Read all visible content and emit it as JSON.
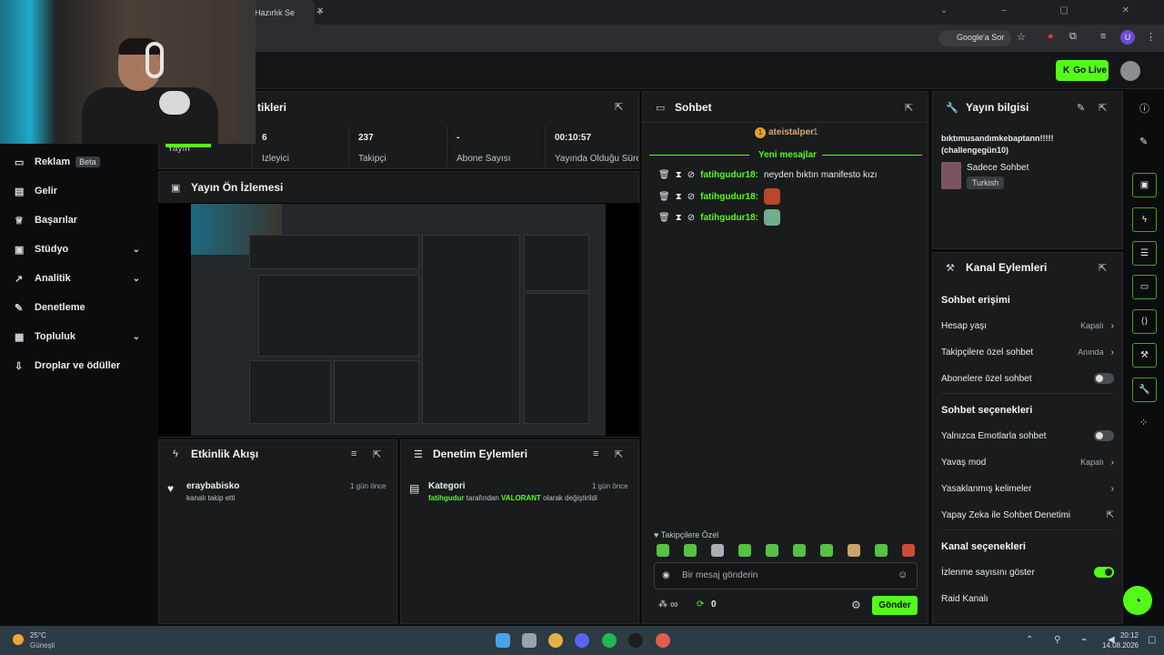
{
  "browser": {
    "tab_title": "Hazırlık Se",
    "google_button": "Google'a Sor",
    "profile_letter": "U"
  },
  "header": {
    "go_live": "Go Live"
  },
  "sidebar": {
    "items": [
      {
        "label": "Reklam",
        "badge": "Beta",
        "icon": "ad-icon"
      },
      {
        "label": "Gelir",
        "icon": "revenue-icon"
      },
      {
        "label": "Başarılar",
        "icon": "trophy-icon"
      },
      {
        "label": "Stüdyo",
        "icon": "studio-icon",
        "expandable": true
      },
      {
        "label": "Analitik",
        "icon": "analytics-icon",
        "expandable": true
      },
      {
        "label": "Denetleme",
        "icon": "moderation-icon"
      },
      {
        "label": "Topluluk",
        "icon": "community-icon",
        "expandable": true
      },
      {
        "label": "Droplar ve ödüller",
        "icon": "drops-icon"
      }
    ]
  },
  "stats_panel": {
    "title": "tikleri",
    "stats": [
      {
        "value": "",
        "label": "Yayın"
      },
      {
        "value": "6",
        "label": "İzleyici"
      },
      {
        "value": "237",
        "label": "Takipçi"
      },
      {
        "value": "-",
        "label": "Abone Sayısı"
      },
      {
        "value": "00:10:57",
        "label": "Yayında Olduğu Süre"
      }
    ]
  },
  "preview_panel": {
    "title": "Yayın Ön İzlemesi"
  },
  "activity_panel": {
    "title": "Etkinlik Akışı",
    "items": [
      {
        "user": "eraybabisko",
        "text": "kanalı takip etti",
        "time": "1 gün önce"
      }
    ]
  },
  "moderation_panel": {
    "title": "Denetim Eylemleri",
    "items": [
      {
        "title": "Kategori",
        "user": "fatihgudur",
        "mid": "tarafından",
        "value": "VALORANT",
        "end": "olarak değiştirildi",
        "time": "1 gün önce"
      }
    ]
  },
  "chat": {
    "title": "Sohbet",
    "pinned_user": "ateistalper",
    "pinned_count": "1",
    "new_messages": "Yeni mesajlar",
    "messages": [
      {
        "user": "fatihgudur18:",
        "text": "neyden bıktın manifesto kızı"
      },
      {
        "user": "fatihgudur18:",
        "text": ""
      },
      {
        "user": "fatihgudur18:",
        "text": ""
      }
    ],
    "followers_only": "Takipçilere Özel",
    "input_placeholder": "Bir mesaj gönderin",
    "infinity": "∞",
    "points": "0",
    "send": "Gönder"
  },
  "stream_info": {
    "title": "Yayın bilgisi",
    "stream_title": "bıktımusandımkebaptann!!!!! (challengegün10)",
    "category": "Sadece Sohbet",
    "language": "Turkish"
  },
  "channel_actions": {
    "title": "Kanal Eylemleri",
    "sections": {
      "chat_access": "Sohbet erişimi",
      "chat_options": "Sohbet seçenekleri",
      "channel_options": "Kanal seçenekleri"
    },
    "account_age": {
      "label": "Hesap yaşı",
      "value": "Kapalı"
    },
    "followers_chat": {
      "label": "Takipçilere özel sohbet",
      "value": "Anında"
    },
    "subs_chat": {
      "label": "Abonelere özel sohbet"
    },
    "emote_only": {
      "label": "Yalnızca Emotlarla sohbet"
    },
    "slow_mode": {
      "label": "Yavaş mod",
      "value": "Kapalı"
    },
    "banned_words": {
      "label": "Yasaklanmış kelimeler"
    },
    "ai_moderation": {
      "label": "Yapay Zeka ile Sohbet Denetimi"
    },
    "show_viewers": {
      "label": "İzlenme sayısını göster"
    },
    "raid": {
      "label": "Raid Kanalı"
    }
  },
  "taskbar": {
    "weather_temp": "25°C",
    "weather_text": "Güneşli",
    "time": "20:12",
    "date": "14.08.2026"
  },
  "colors": {
    "accent": "#53fc18",
    "panel": "#191b1c",
    "background": "#0b0c0d"
  }
}
